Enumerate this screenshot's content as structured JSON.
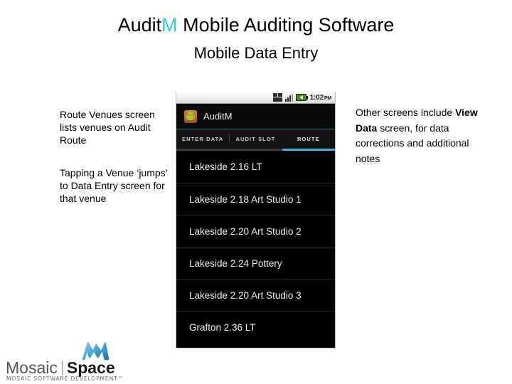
{
  "slide": {
    "title_prefix": "Audit",
    "title_accent": "M",
    "title_suffix": " Mobile Auditing Software",
    "subtitle": "Mobile Data Entry",
    "accent_color": "#2ec8e6"
  },
  "left_notes": [
    "Route Venues screen  lists venues on Audit Route",
    "Tapping a Venue ‘jumps’ to Data Entry screen for that venue"
  ],
  "right_note": {
    "lead": "Other screens include ",
    "emphasis": "View Data",
    "tail": " screen, for data corrections and additional notes"
  },
  "phone": {
    "statusbar": {
      "usb_icon": "usb-debug-icon",
      "signal_icon": "signal-bars-icon",
      "battery_icon": "battery-charging-icon",
      "time": "1:02",
      "meridiem": "PM"
    },
    "appbar": {
      "icon": "android-robot-icon",
      "title": "AuditM"
    },
    "tabs": [
      {
        "label": "ENTER DATA",
        "active": false
      },
      {
        "label": "AUDIT SLOT",
        "active": false
      },
      {
        "label": "ROUTE",
        "active": true
      }
    ],
    "venues": [
      "Lakeside 2.16 LT",
      "Lakeside 2.18 Art Studio 1",
      "Lakeside 2.20 Art Studio 2",
      "Lakeside 2.24 Pottery",
      "Lakeside 2.20 Art Studio 3",
      "Grafton 2.36 LT"
    ],
    "tab_active_color": "#2fb6d6"
  },
  "logo": {
    "mark": "mosaic-m-logo-icon",
    "word_one": "Mosaic",
    "word_two": "Space",
    "tagline": "MOSAIC SOFTWARE DEVELOPMENT™",
    "mark_color": "#2f8fc4"
  }
}
